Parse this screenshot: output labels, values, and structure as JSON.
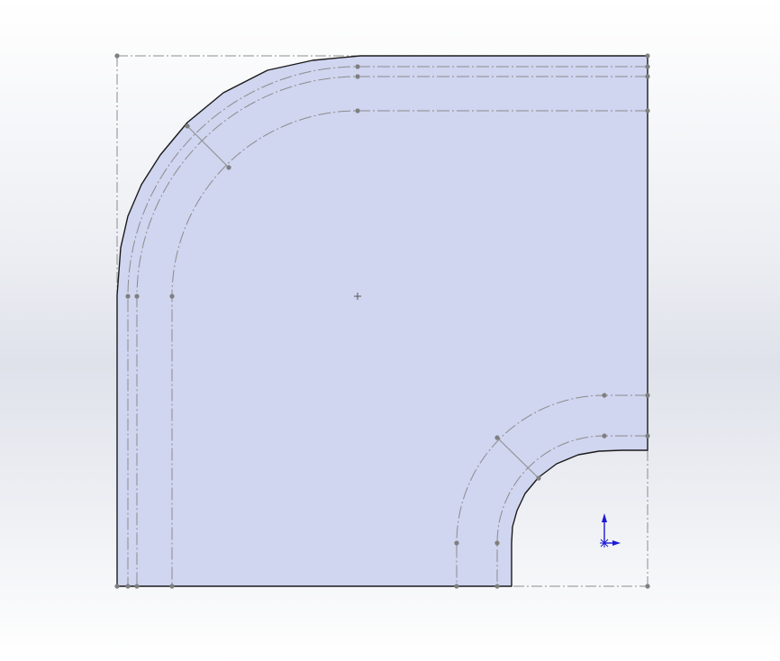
{
  "viewport": {
    "name": "sheet-metal-flat-pattern-view"
  },
  "colors": {
    "face_fill": "#d0d5f0",
    "face_edge": "#1a1a1a",
    "construction_line": "#8c8c8c",
    "sketch_point": "#7f7f7f",
    "origin_axis": "#1b1bd6"
  },
  "icons": {
    "origin": "coordinate-triad-icon",
    "center_mark": "plus-marker-icon"
  }
}
